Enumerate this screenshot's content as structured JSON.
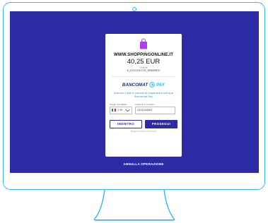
{
  "colors": {
    "screen_bg": "#2d2aa6",
    "frame_outline": "#3ab4f2",
    "bag_icon": "#b03df5",
    "instruction_text": "#2f8fd6",
    "primary_button": "#2d2aa6",
    "flag_italy": [
      "#1c9a48",
      "#ffffff",
      "#d6262f"
    ]
  },
  "payment": {
    "merchant": "WWW.SHOPPINGONLINE.IT",
    "amount": "40,25 EUR",
    "order_label": "Ordine",
    "order_id": "S_0111010710_38349870"
  },
  "brand": {
    "name": "BANCOMAT",
    "pay": "PAY",
    "icon": "bancomat-arrow-icon"
  },
  "instructions": "Inserisci i dati e procedi al pagamento sull'app Bancomat Pay",
  "form": {
    "prefix_label": "Scegli il prefisso",
    "prefix_value": "+39",
    "number_label": "Inserisci il numero",
    "number_value": "3331234567"
  },
  "buttons": {
    "back": "INDIETRO",
    "next": "PROSEGUI"
  },
  "provider": "Pagamento Bancomat Italia",
  "cancel": "ANNULLA OPERAZIONE"
}
